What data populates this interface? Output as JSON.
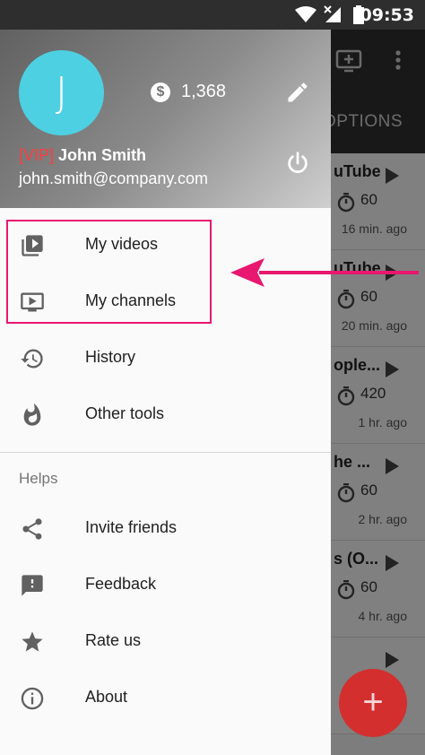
{
  "status_bar": {
    "time": "09:53"
  },
  "background_app": {
    "tab_label": "OPTIONS",
    "items": [
      {
        "title": "uTube",
        "value": "60",
        "ago": "16 min. ago"
      },
      {
        "title": "uTube",
        "value": "60",
        "ago": "20 min. ago"
      },
      {
        "title": "ople...",
        "value": "420",
        "ago": "1 hr. ago"
      },
      {
        "title": "he ...",
        "value": "60",
        "ago": "2 hr. ago"
      },
      {
        "title": "s (O...",
        "value": "60",
        "ago": "4 hr. ago"
      },
      {
        "title": "",
        "value": "",
        "ago": ""
      }
    ],
    "fab_label": "+"
  },
  "drawer": {
    "avatar_letter": "J",
    "coins": "1,368",
    "vip_tag": "[VIP]",
    "user_name": "John Smith",
    "email": "john.smith@company.com",
    "items": [
      {
        "label": "My videos",
        "icon": "video-library-icon"
      },
      {
        "label": "My channels",
        "icon": "tv-play-icon"
      },
      {
        "label": "History",
        "icon": "history-icon"
      },
      {
        "label": "Other tools",
        "icon": "flame-icon"
      }
    ],
    "section_title": "Helps",
    "help_items": [
      {
        "label": "Invite friends",
        "icon": "share-icon"
      },
      {
        "label": "Feedback",
        "icon": "feedback-icon"
      },
      {
        "label": "Rate us",
        "icon": "star-icon"
      },
      {
        "label": "About",
        "icon": "info-icon"
      }
    ]
  },
  "colors": {
    "highlight": "#e8176f",
    "avatar": "#4dd0e1",
    "vip": "#ff3d3d",
    "fab": "#d32f2f"
  }
}
